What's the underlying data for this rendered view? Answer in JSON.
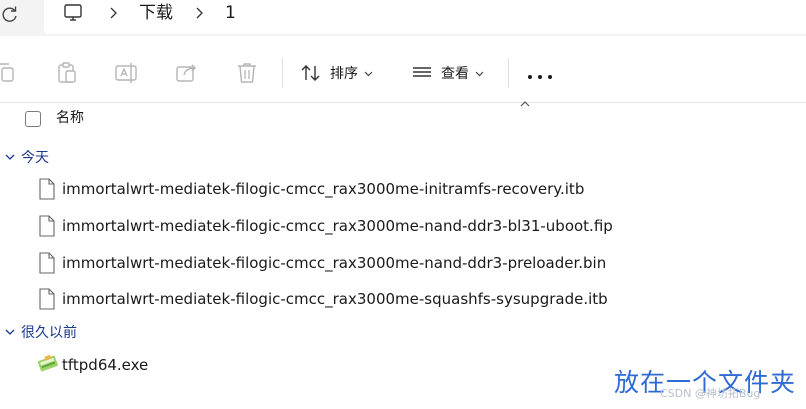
{
  "address": {
    "refresh_icon": "refresh-icon",
    "computer_icon": "monitor-icon",
    "crumbs": [
      "下载",
      "1"
    ]
  },
  "toolbar": {
    "icons": [
      "copy-icon",
      "paste-icon",
      "rename-icon",
      "share-icon",
      "delete-icon"
    ],
    "sort_label": "排序",
    "view_label": "查看",
    "more_icon": "more-horizontal-icon"
  },
  "columns": {
    "name_header": "名称"
  },
  "groups": [
    {
      "label": "今天",
      "files": [
        {
          "name": "immortalwrt-mediatek-filogic-cmcc_rax3000me-initramfs-recovery.itb",
          "icon": "document-icon"
        },
        {
          "name": "immortalwrt-mediatek-filogic-cmcc_rax3000me-nand-ddr3-bl31-uboot.fip",
          "icon": "document-icon"
        },
        {
          "name": "immortalwrt-mediatek-filogic-cmcc_rax3000me-nand-ddr3-preloader.bin",
          "icon": "document-icon"
        },
        {
          "name": "immortalwrt-mediatek-filogic-cmcc_rax3000me-squashfs-sysupgrade.itb",
          "icon": "document-icon"
        }
      ]
    },
    {
      "label": "很久以前",
      "files": [
        {
          "name": "tftpd64.exe",
          "icon": "exe-icon"
        }
      ]
    }
  ],
  "overlay": {
    "watermark": "放在一个文件夹",
    "credit": "CSDN @神坊拓Bug"
  },
  "colors": {
    "group_header": "#1b3a8c",
    "watermark": "#2f6bd3",
    "toolbar_icons_disabled": "#b5b5b5"
  }
}
